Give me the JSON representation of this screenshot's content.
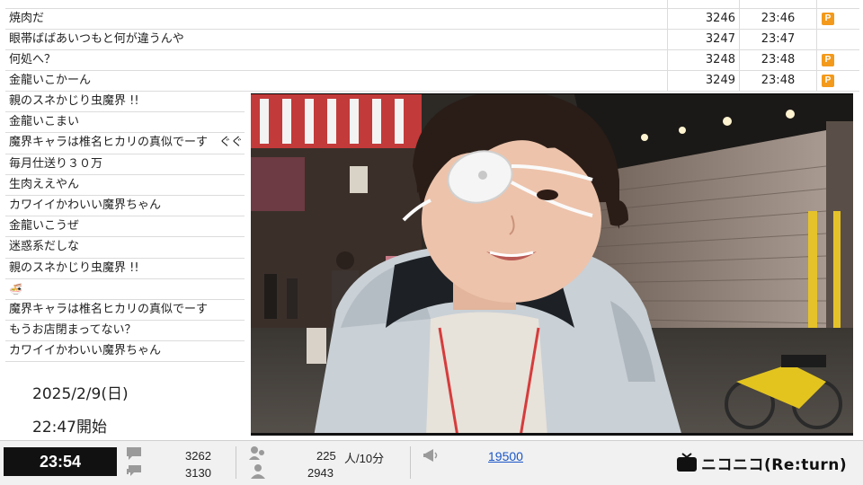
{
  "comments_top": [
    {
      "text": "焼肉だ",
      "no": "3246",
      "time": "23:46",
      "premium": true
    },
    {
      "text": "眼帯ばばあいつもと何が違うんや",
      "no": "3247",
      "time": "23:47",
      "premium": false
    },
    {
      "text": "何処へ？",
      "no": "3248",
      "time": "23:48",
      "premium": true
    },
    {
      "text": "金龍いこかーん",
      "no": "3249",
      "time": "23:48",
      "premium": true
    }
  ],
  "premium_mark": "P",
  "comments_side": [
    "親のスネかじり虫魔界 !!",
    "金龍いこまい",
    "魔界キャラは椎名ヒカリの真似でーす　ぐぐって",
    "毎月仕送り３０万",
    "生肉ええやん",
    "カワイイかわいい魔界ちゃん",
    "金龍いこうぜ",
    "迷惑系だしな",
    "親のスネかじり虫魔界 !!",
    "🍜",
    "魔界キャラは椎名ヒカリの真似でーす",
    "もうお店閉まってない？",
    "カワイイかわいい魔界ちゃん"
  ],
  "broadcast": {
    "date": "2025/2/9(日)",
    "start": "22:47開始"
  },
  "status": {
    "clock": "23:54",
    "comment_count_a": "3262",
    "comment_count_b": "3130",
    "viewer_rate_value": "225",
    "viewer_rate_unit": "人/10分",
    "viewer_total": "2943",
    "ad_points": "19500"
  },
  "brand": {
    "name": "ニコニコ(Re:turn)"
  },
  "colors": {
    "premium": "#f39a1c",
    "link": "#1a56c8",
    "clock_bg": "#111111"
  }
}
